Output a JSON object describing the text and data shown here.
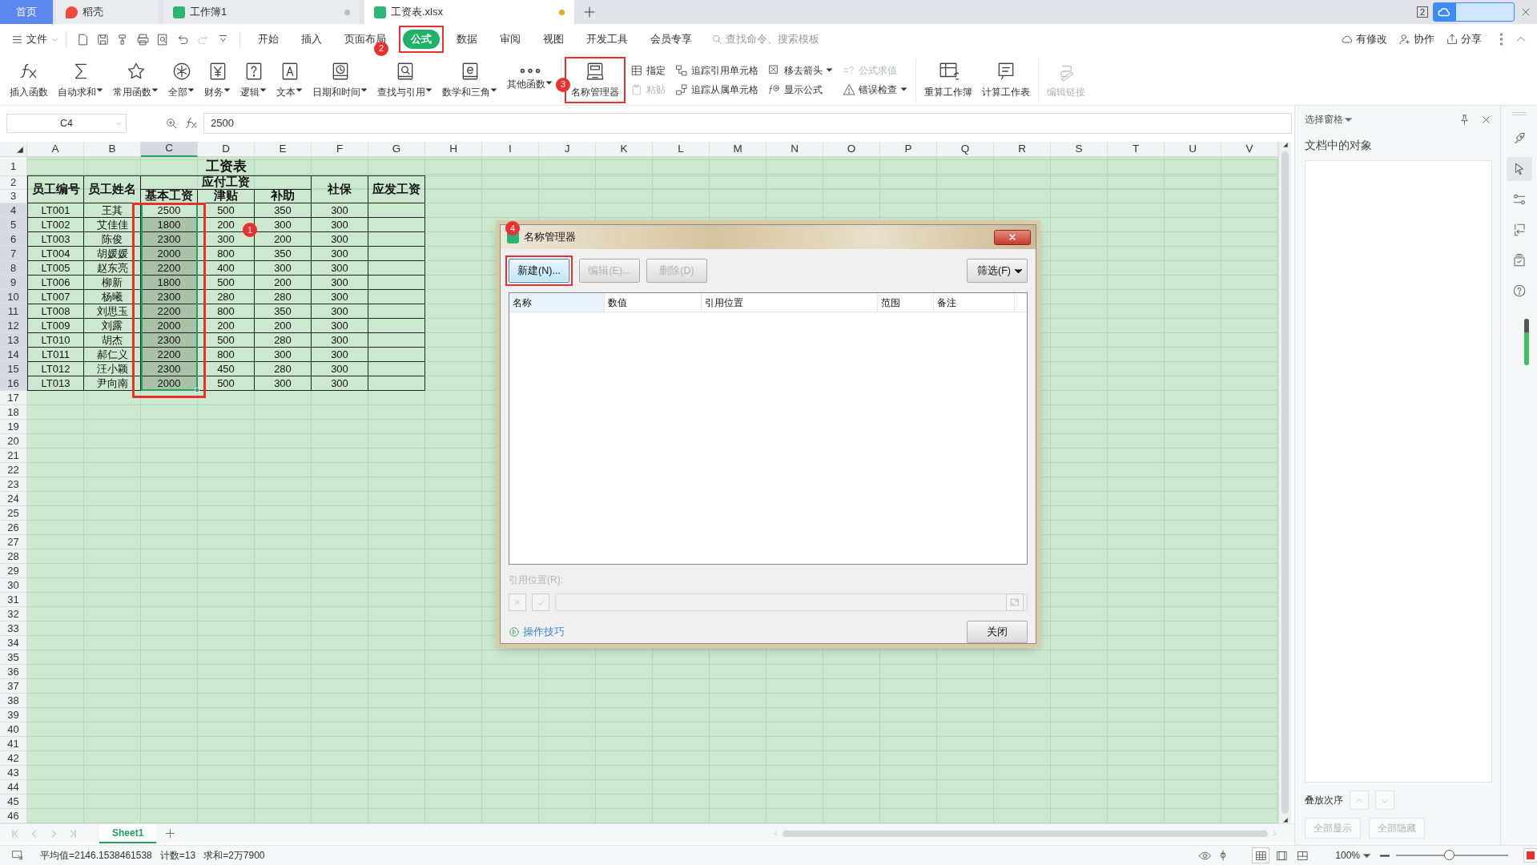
{
  "tabs": [
    {
      "label": "首页",
      "kind": "home",
      "selected": false
    },
    {
      "label": "稻壳",
      "kind": "docer",
      "selected": false
    },
    {
      "label": "工作簿1",
      "kind": "sheet",
      "selected": false,
      "unsaved": false
    },
    {
      "label": "工资表.xlsx",
      "kind": "sheet",
      "selected": true,
      "unsaved": true
    }
  ],
  "window_count": "2",
  "menu": {
    "file": "文件",
    "quick_access": [
      {
        "disabled": false
      },
      {
        "disabled": false
      },
      {
        "disabled": false
      },
      {
        "disabled": false
      },
      {
        "disabled": false
      },
      {
        "disabled": false
      },
      {
        "disabled": true
      },
      {
        "disabled": false
      }
    ],
    "items": [
      {
        "label": "开始",
        "selected": false
      },
      {
        "label": "插入",
        "selected": false
      },
      {
        "label": "页面布局",
        "selected": false
      },
      {
        "label": "公式",
        "selected": true,
        "highlighted": true,
        "step": "2"
      },
      {
        "label": "数据",
        "selected": false
      },
      {
        "label": "审阅",
        "selected": false
      },
      {
        "label": "视图",
        "selected": false
      },
      {
        "label": "开发工具",
        "selected": false
      },
      {
        "label": "会员专享",
        "selected": false
      }
    ],
    "search": {
      "placeholder": "查找命令、搜索模板"
    },
    "actions": [
      "有修改",
      "协作",
      "分享"
    ]
  },
  "ribbon": [
    [
      {
        "kind": "large",
        "label": "插入函数",
        "dropdown": false,
        "disabled": false
      },
      {
        "kind": "large",
        "label": "自动求和",
        "dropdown": true,
        "disabled": false
      },
      {
        "kind": "large",
        "label": "常用函数",
        "dropdown": true,
        "disabled": false
      },
      {
        "kind": "large",
        "label": "全部",
        "dropdown": true,
        "disabled": false
      },
      {
        "kind": "large",
        "label": "财务",
        "dropdown": true,
        "disabled": false
      },
      {
        "kind": "large",
        "label": "逻辑",
        "dropdown": true,
        "disabled": false
      },
      {
        "kind": "large",
        "label": "文本",
        "dropdown": true,
        "disabled": false
      },
      {
        "kind": "large",
        "label": "日期和时间",
        "dropdown": true,
        "disabled": false
      },
      {
        "kind": "large",
        "label": "查找与引用",
        "dropdown": true,
        "disabled": false
      },
      {
        "kind": "large",
        "label": "数学和三角",
        "dropdown": true,
        "disabled": false
      },
      {
        "kind": "large",
        "label": "其他函数",
        "dropdown": true,
        "disabled": false
      }
    ],
    [
      {
        "kind": "large",
        "label": "名称管理器",
        "dropdown": false,
        "disabled": false,
        "highlighted": true,
        "step": "3"
      },
      {
        "kind": "stack",
        "items": [
          {
            "label": "指定",
            "dropdown": false,
            "disabled": false
          },
          {
            "label": "粘贴",
            "dropdown": false,
            "disabled": true
          }
        ]
      },
      {
        "kind": "stack",
        "items": [
          {
            "label": "追踪引用单元格",
            "dropdown": false,
            "disabled": false
          },
          {
            "label": "追踪从属单元格",
            "dropdown": false,
            "disabled": false
          }
        ]
      },
      {
        "kind": "stack",
        "items": [
          {
            "label": "移去箭头",
            "dropdown": true,
            "disabled": false
          },
          {
            "label": "显示公式",
            "dropdown": false,
            "disabled": false
          }
        ]
      },
      {
        "kind": "stack",
        "items": [
          {
            "label": "公式求值",
            "dropdown": false,
            "disabled": true
          },
          {
            "label": "错误检查",
            "dropdown": true,
            "disabled": false
          }
        ]
      }
    ],
    [
      {
        "kind": "large",
        "label": "重算工作簿",
        "dropdown": false,
        "disabled": false
      },
      {
        "kind": "large",
        "label": "计算工作表",
        "dropdown": false,
        "disabled": false
      }
    ],
    [
      {
        "kind": "large",
        "label": "编辑链接",
        "dropdown": false,
        "disabled": true
      }
    ]
  ],
  "formula_bar": {
    "cell": "C4",
    "value": "2500"
  },
  "sheet": {
    "columns": [
      {
        "label": "A",
        "selected": false
      },
      {
        "label": "B",
        "selected": false
      },
      {
        "label": "C",
        "selected": true
      },
      {
        "label": "D",
        "selected": false
      },
      {
        "label": "E",
        "selected": false
      },
      {
        "label": "F",
        "selected": false
      },
      {
        "label": "G",
        "selected": false
      },
      {
        "label": "H",
        "selected": false
      },
      {
        "label": "I",
        "selected": false
      },
      {
        "label": "J",
        "selected": false
      },
      {
        "label": "K",
        "selected": false
      },
      {
        "label": "L",
        "selected": false
      },
      {
        "label": "M",
        "selected": false
      },
      {
        "label": "N",
        "selected": false
      },
      {
        "label": "O",
        "selected": false
      },
      {
        "label": "P",
        "selected": false
      },
      {
        "label": "Q",
        "selected": false
      },
      {
        "label": "R",
        "selected": false
      },
      {
        "label": "S",
        "selected": false
      },
      {
        "label": "T",
        "selected": false
      },
      {
        "label": "U",
        "selected": false
      },
      {
        "label": "V",
        "selected": false
      }
    ],
    "rows": [
      {
        "label": "1",
        "selected": false
      },
      {
        "label": "2",
        "selected": false
      },
      {
        "label": "3",
        "selected": false
      },
      {
        "label": "4",
        "selected": true
      },
      {
        "label": "5",
        "selected": true
      },
      {
        "label": "6",
        "selected": true
      },
      {
        "label": "7",
        "selected": true
      },
      {
        "label": "8",
        "selected": true
      },
      {
        "label": "9",
        "selected": true
      },
      {
        "label": "10",
        "selected": true
      },
      {
        "label": "11",
        "selected": true
      },
      {
        "label": "12",
        "selected": true
      },
      {
        "label": "13",
        "selected": true
      },
      {
        "label": "14",
        "selected": true
      },
      {
        "label": "15",
        "selected": true
      },
      {
        "label": "16",
        "selected": true
      },
      {
        "label": "17",
        "selected": false
      },
      {
        "label": "18",
        "selected": false
      },
      {
        "label": "19",
        "selected": false
      },
      {
        "label": "20",
        "selected": false
      },
      {
        "label": "21",
        "selected": false
      },
      {
        "label": "22",
        "selected": false
      },
      {
        "label": "23",
        "selected": false
      },
      {
        "label": "24",
        "selected": false
      },
      {
        "label": "25",
        "selected": false
      },
      {
        "label": "26",
        "selected": false
      },
      {
        "label": "27",
        "selected": false
      },
      {
        "label": "28",
        "selected": false
      },
      {
        "label": "29",
        "selected": false
      },
      {
        "label": "30",
        "selected": false
      },
      {
        "label": "31",
        "selected": false
      },
      {
        "label": "32",
        "selected": false
      },
      {
        "label": "33",
        "selected": false
      },
      {
        "label": "34",
        "selected": false
      },
      {
        "label": "35",
        "selected": false
      },
      {
        "label": "36",
        "selected": false
      },
      {
        "label": "37",
        "selected": false
      },
      {
        "label": "38",
        "selected": false
      },
      {
        "label": "39",
        "selected": false
      },
      {
        "label": "40",
        "selected": false
      },
      {
        "label": "41",
        "selected": false
      },
      {
        "label": "42",
        "selected": false
      },
      {
        "label": "43",
        "selected": false
      },
      {
        "label": "44",
        "selected": false
      },
      {
        "label": "45",
        "selected": false
      },
      {
        "label": "46",
        "selected": false
      }
    ],
    "table": {
      "title": "工资表",
      "header": {
        "left": [
          "员工编号",
          "员工姓名"
        ],
        "group": "应付工资",
        "sub": [
          "基本工资",
          "津贴",
          "补助"
        ],
        "right": [
          "社保",
          "应发工资"
        ]
      },
      "records": [
        [
          "LT001",
          "王其",
          "2500",
          "500",
          "350",
          "300"
        ],
        [
          "LT002",
          "艾佳佳",
          "1800",
          "200",
          "300",
          "300"
        ],
        [
          "LT003",
          "陈俊",
          "2300",
          "300",
          "200",
          "300"
        ],
        [
          "LT004",
          "胡媛媛",
          "2000",
          "800",
          "350",
          "300"
        ],
        [
          "LT005",
          "赵东亮",
          "2200",
          "400",
          "300",
          "300"
        ],
        [
          "LT006",
          "柳新",
          "1800",
          "500",
          "200",
          "300"
        ],
        [
          "LT007",
          "杨曦",
          "2300",
          "280",
          "280",
          "300"
        ],
        [
          "LT008",
          "刘思玉",
          "2200",
          "800",
          "350",
          "300"
        ],
        [
          "LT009",
          "刘露",
          "2000",
          "200",
          "200",
          "300"
        ],
        [
          "LT010",
          "胡杰",
          "2300",
          "500",
          "280",
          "300"
        ],
        [
          "LT011",
          "郝仁义",
          "2200",
          "800",
          "300",
          "300"
        ],
        [
          "LT012",
          "汪小颖",
          "2300",
          "450",
          "280",
          "300"
        ],
        [
          "LT013",
          "尹向南",
          "2000",
          "500",
          "300",
          "300"
        ]
      ]
    },
    "selection": {
      "highlighted": true,
      "step": "1"
    },
    "sheet_tabs": [
      {
        "label": "Sheet1",
        "selected": true
      }
    ]
  },
  "dialog": {
    "title": "名称管理器",
    "step": "4",
    "buttons": [
      {
        "label": "新建(N)...",
        "disabled": false,
        "highlighted": true
      },
      {
        "label": "编辑(E)...",
        "disabled": true,
        "highlighted": false
      },
      {
        "label": "删除(D)",
        "disabled": true,
        "highlighted": false
      }
    ],
    "filter": "筛选(F)",
    "columns": [
      "名称",
      "数值",
      "引用位置",
      "范围",
      "备注"
    ],
    "ref_label": "引用位置(R):",
    "tips": "操作技巧",
    "close": "关闭"
  },
  "selection_pane": {
    "title": "选择窗格",
    "heading": "文档中的对象",
    "order_label": "叠放次序",
    "buttons": [
      {
        "label": "全部显示",
        "disabled": true
      },
      {
        "label": "全部隐藏",
        "disabled": true
      }
    ]
  },
  "side_tools": [
    {
      "selected": false
    },
    {
      "selected": true
    },
    {
      "selected": false
    },
    {
      "selected": false
    },
    {
      "selected": false
    },
    {
      "selected": false
    }
  ],
  "status_bar": {
    "stats": [
      "平均值=2146.1538461538",
      "计数=13",
      "求和=2万7900"
    ],
    "views": [
      {
        "selected": true
      },
      {
        "selected": false
      },
      {
        "selected": false
      }
    ],
    "zoom": "100%",
    "zoom_slider": {
      "level": 0.47
    }
  }
}
